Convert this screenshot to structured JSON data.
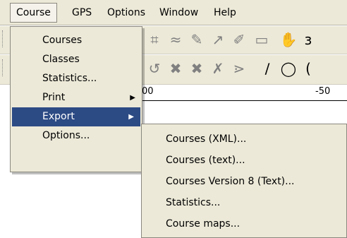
{
  "menubar": {
    "items": [
      {
        "label": "Course",
        "active": true
      },
      {
        "label": "GPS",
        "active": false
      },
      {
        "label": "Options",
        "active": false
      },
      {
        "label": "Window",
        "active": false
      },
      {
        "label": "Help",
        "active": false
      }
    ]
  },
  "course_menu": {
    "items": [
      {
        "label": "Courses",
        "has_submenu": false
      },
      {
        "label": "Classes",
        "has_submenu": false
      },
      {
        "label": "Statistics...",
        "has_submenu": false
      },
      {
        "label": "Print",
        "has_submenu": true
      },
      {
        "label": "Export",
        "has_submenu": true
      },
      {
        "label": "Options...",
        "has_submenu": false
      }
    ],
    "highlighted": "Export"
  },
  "export_menu": {
    "items": [
      {
        "label": "Courses (XML)..."
      },
      {
        "label": "Courses (text)..."
      },
      {
        "label": "Courses Version 8 (Text)..."
      },
      {
        "label": "Statistics..."
      },
      {
        "label": "Course maps..."
      }
    ]
  },
  "ruler": {
    "left_label": "00",
    "right_label": "-50"
  },
  "colors": {
    "menu_bg": "#ece9d8",
    "highlight": "#2c4a84",
    "highlight_text": "#ffffff"
  }
}
